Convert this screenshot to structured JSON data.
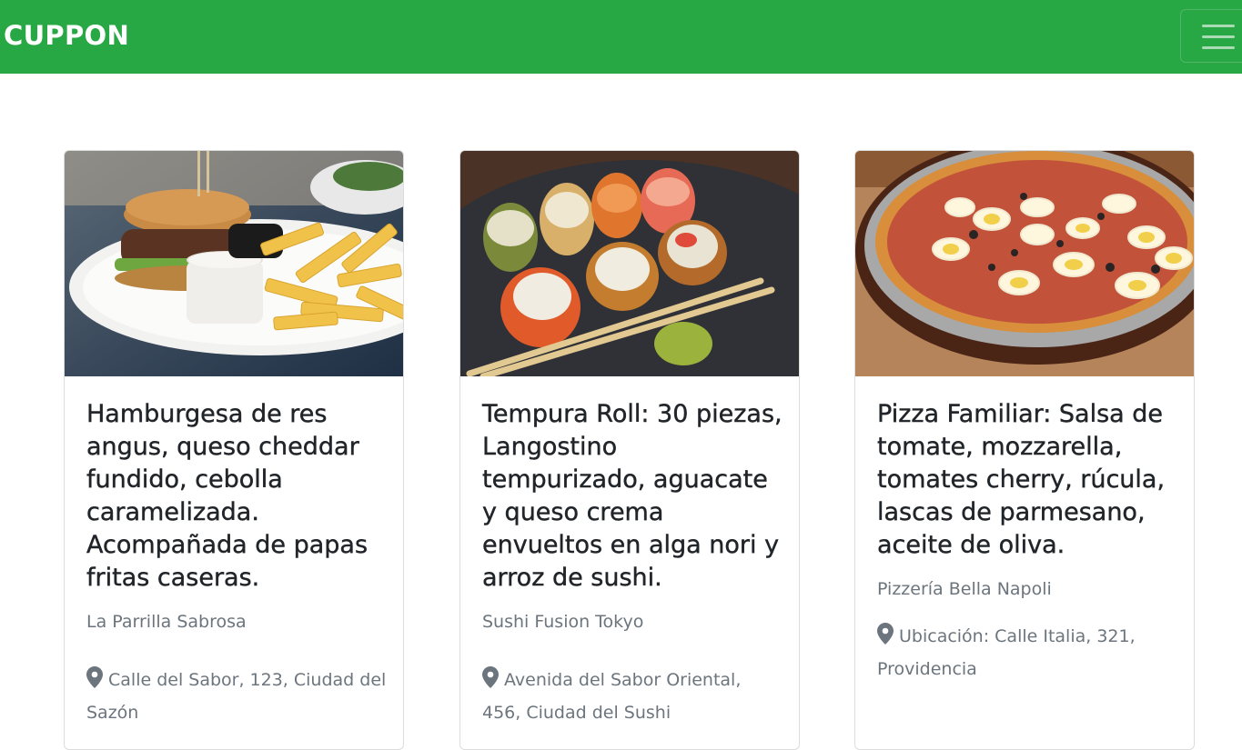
{
  "navbar": {
    "brand": "CUPPON",
    "toggle_icon": "hamburger-menu-icon",
    "color": "#28a745"
  },
  "cards": [
    {
      "title": "Hamburgesa de res angus, queso cheddar fundido, cebolla caramelizada. Acompañada de papas fritas caseras.",
      "restaurant": "La Parrilla Sabrosa",
      "location": "Calle del Sabor, 123, Ciudad del Sazón",
      "location_icon": "map-pin-icon",
      "image": "burger-and-fries-photo"
    },
    {
      "title": "Tempura Roll: 30 piezas, Langostino tempurizado, aguacate y queso crema envueltos en alga nori y arroz de sushi.",
      "restaurant": "Sushi Fusion Tokyo",
      "location": "Avenida del Sabor Oriental, 456, Ciudad del Sushi",
      "location_icon": "map-pin-icon",
      "image": "sushi-rolls-photo"
    },
    {
      "title": "Pizza Familiar: Salsa de tomate, mozzarella, tomates cherry, rúcula, lascas de parmesano, aceite de oliva.",
      "restaurant": "Pizzería Bella Napoli",
      "location": "Ubicación: Calle Italia, 321, Providencia",
      "location_icon": "map-pin-icon",
      "image": "pizza-photo"
    }
  ]
}
